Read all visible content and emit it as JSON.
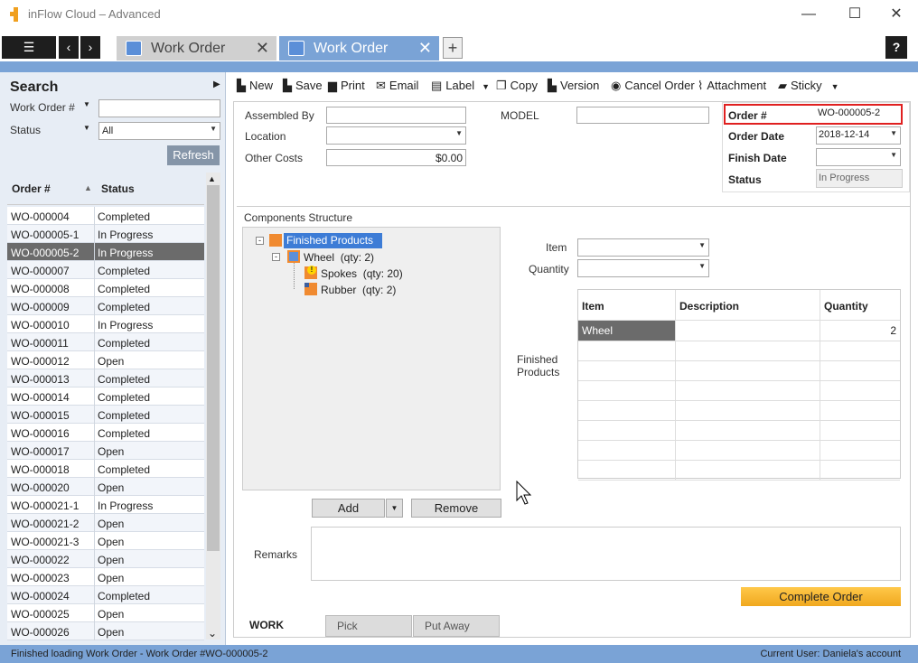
{
  "window": {
    "title": "inFlow Cloud – Advanced"
  },
  "tabs": [
    {
      "label": "Work Order"
    },
    {
      "label": "Work Order"
    }
  ],
  "search": {
    "title": "Search",
    "work_order_label": "Work Order #",
    "work_order_value": "",
    "status_label": "Status",
    "status_value": "All",
    "refresh_label": "Refresh"
  },
  "list": {
    "col_order": "Order #",
    "col_status": "Status",
    "rows": [
      {
        "order": "WO-000004",
        "status": "Completed"
      },
      {
        "order": "WO-000005-1",
        "status": "In Progress"
      },
      {
        "order": "WO-000005-2",
        "status": "In Progress"
      },
      {
        "order": "WO-000007",
        "status": "Completed"
      },
      {
        "order": "WO-000008",
        "status": "Completed"
      },
      {
        "order": "WO-000009",
        "status": "Completed"
      },
      {
        "order": "WO-000010",
        "status": "In Progress"
      },
      {
        "order": "WO-000011",
        "status": "Completed"
      },
      {
        "order": "WO-000012",
        "status": "Open"
      },
      {
        "order": "WO-000013",
        "status": "Completed"
      },
      {
        "order": "WO-000014",
        "status": "Completed"
      },
      {
        "order": "WO-000015",
        "status": "Completed"
      },
      {
        "order": "WO-000016",
        "status": "Completed"
      },
      {
        "order": "WO-000017",
        "status": "Open"
      },
      {
        "order": "WO-000018",
        "status": "Completed"
      },
      {
        "order": "WO-000020",
        "status": "Open"
      },
      {
        "order": "WO-000021-1",
        "status": "In Progress"
      },
      {
        "order": "WO-000021-2",
        "status": "Open"
      },
      {
        "order": "WO-000021-3",
        "status": "Open"
      },
      {
        "order": "WO-000022",
        "status": "Open"
      },
      {
        "order": "WO-000023",
        "status": "Open"
      },
      {
        "order": "WO-000024",
        "status": "Completed"
      },
      {
        "order": "WO-000025",
        "status": "Open"
      },
      {
        "order": "WO-000026",
        "status": "Open"
      }
    ]
  },
  "toolbar": {
    "new": "New",
    "save": "Save",
    "print": "Print",
    "email": "Email",
    "label": "Label",
    "copy": "Copy",
    "version": "Version",
    "cancel_order": "Cancel Order",
    "attachment": "Attachment",
    "sticky": "Sticky"
  },
  "form": {
    "assembled_by_label": "Assembled By",
    "location_label": "Location",
    "other_costs_label": "Other Costs",
    "other_costs_value": "$0.00",
    "model_label": "MODEL",
    "order_label": "Order #",
    "order_value": "WO-000005-2",
    "order_date_label": "Order Date",
    "order_date_value": "2018-12-14",
    "finish_date_label": "Finish Date",
    "status_label": "Status",
    "status_value": "In Progress"
  },
  "components": {
    "title": "Components Structure",
    "root": "Finished Products",
    "wheel": "Wheel",
    "wheel_qty": "(qty: 2)",
    "spokes": "Spokes",
    "spokes_qty": "(qty: 20)",
    "rubber": "Rubber",
    "rubber_qty": "(qty: 2)",
    "add_label": "Add",
    "remove_label": "Remove",
    "item_label": "Item",
    "quantity_label": "Quantity",
    "finished_products_label_1": "Finished",
    "finished_products_label_2": "Products"
  },
  "grid": {
    "col_item": "Item",
    "col_desc": "Description",
    "col_qty": "Quantity",
    "row_item": "Wheel",
    "row_desc": "",
    "row_qty": "2"
  },
  "remarks_label": "Remarks",
  "complete_label": "Complete Order",
  "bottom_tabs": {
    "work": "WORK",
    "pick": "Pick",
    "put_away": "Put Away"
  },
  "status": {
    "message": "Finished loading Work Order - Work Order #WO-000005-2",
    "user": "Current User:  Daniela's account"
  },
  "colors": {
    "accent": "#7aa3d6",
    "selected_row": "#6b6b6b",
    "highlight": "#e02020",
    "complete_button": "#f0a81e"
  }
}
